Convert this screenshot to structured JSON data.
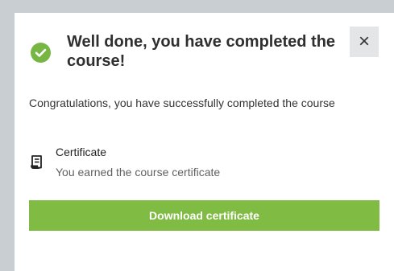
{
  "colors": {
    "accent": "#80bc44",
    "check": "#77b643",
    "backdrop": "#c9ced3"
  },
  "dialog": {
    "title": "Well done, you have completed the course!",
    "check_icon": "check-circle-icon",
    "close": {
      "label": "×",
      "icon": "close-icon"
    },
    "message": "Congratulations, you have successfully completed the course",
    "certificate": {
      "icon": "certificate-icon",
      "title": "Certificate",
      "subtitle": "You earned the course certificate"
    },
    "download_button_label": "Download certificate"
  }
}
